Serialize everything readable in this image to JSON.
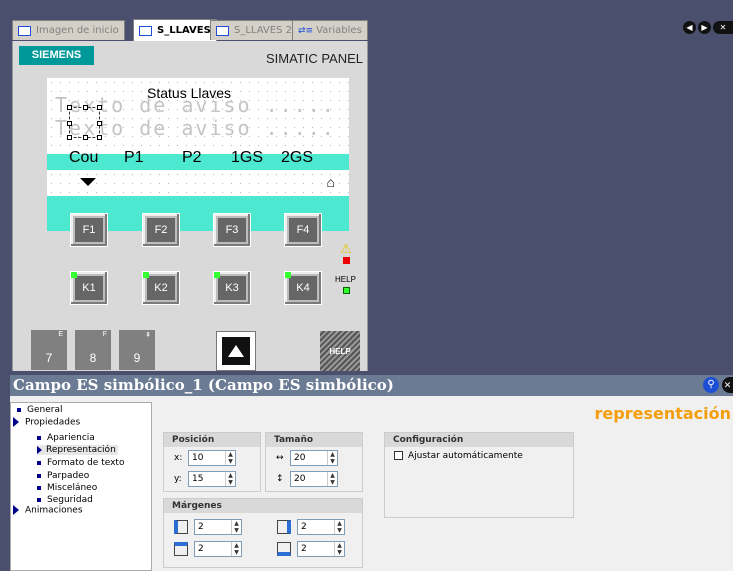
{
  "tabs": [
    {
      "label": "Imagen de inicio",
      "active": false
    },
    {
      "label": "S_LLAVES",
      "active": true
    },
    {
      "label": "S_LLAVES 2",
      "active": false
    },
    {
      "label": "Variables",
      "active": false
    }
  ],
  "panel": {
    "brand": "SIEMENS",
    "model": "SIMATIC PANEL",
    "screen": {
      "ghost_line1": "Texto de aviso .....",
      "ghost_line2": "Texto de aviso .....",
      "title": "Status Llaves",
      "columns": [
        "Cou",
        "P1",
        "P2",
        "1GS",
        "2GS"
      ]
    },
    "fkeys": [
      "F1",
      "F2",
      "F3",
      "F4"
    ],
    "kkeys": [
      "K1",
      "K2",
      "K3",
      "K4"
    ],
    "numkeys": [
      {
        "label": "7",
        "super": "E"
      },
      {
        "label": "8",
        "super": "F"
      },
      {
        "label": "9",
        "super": ""
      }
    ],
    "help_label": "HELP",
    "help_key": "HELP"
  },
  "properties": {
    "title": "Campo ES simbólico_1 (Campo ES simbólico)",
    "section_label": "representación",
    "tree": [
      {
        "label": "General",
        "level": 0,
        "kind": "bullet"
      },
      {
        "label": "Propiedades",
        "level": 0,
        "kind": "arrow"
      },
      {
        "label": "Apariencia",
        "level": 1,
        "kind": "bullet"
      },
      {
        "label": "Representación",
        "level": 1,
        "kind": "arrow-sm",
        "selected": true
      },
      {
        "label": "Formato de texto",
        "level": 1,
        "kind": "bullet"
      },
      {
        "label": "Parpadeo",
        "level": 1,
        "kind": "bullet"
      },
      {
        "label": "Misceláneo",
        "level": 1,
        "kind": "bullet"
      },
      {
        "label": "Seguridad",
        "level": 1,
        "kind": "bullet"
      },
      {
        "label": "Animaciones",
        "level": 0,
        "kind": "arrow"
      }
    ],
    "position": {
      "header": "Posición",
      "x_label": "x:",
      "x": "10",
      "y_label": "y:",
      "y": "15"
    },
    "size": {
      "header": "Tamaño",
      "w": "20",
      "h": "20"
    },
    "config": {
      "header": "Configuración",
      "auto_label": "Ajustar automáticamente"
    },
    "margins": {
      "header": "Márgenes",
      "left": "2",
      "right": "2",
      "top": "2",
      "bottom": "2"
    }
  }
}
